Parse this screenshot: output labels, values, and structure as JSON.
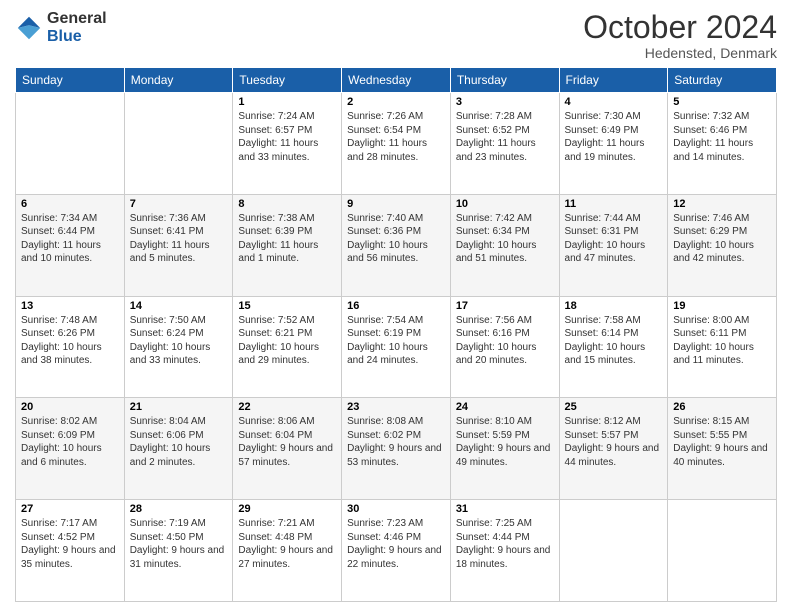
{
  "header": {
    "logo_line1": "General",
    "logo_line2": "Blue",
    "month": "October 2024",
    "location": "Hedensted, Denmark"
  },
  "days_of_week": [
    "Sunday",
    "Monday",
    "Tuesday",
    "Wednesday",
    "Thursday",
    "Friday",
    "Saturday"
  ],
  "weeks": [
    [
      {
        "day": "",
        "info": ""
      },
      {
        "day": "",
        "info": ""
      },
      {
        "day": "1",
        "info": "Sunrise: 7:24 AM\nSunset: 6:57 PM\nDaylight: 11 hours and 33 minutes."
      },
      {
        "day": "2",
        "info": "Sunrise: 7:26 AM\nSunset: 6:54 PM\nDaylight: 11 hours and 28 minutes."
      },
      {
        "day": "3",
        "info": "Sunrise: 7:28 AM\nSunset: 6:52 PM\nDaylight: 11 hours and 23 minutes."
      },
      {
        "day": "4",
        "info": "Sunrise: 7:30 AM\nSunset: 6:49 PM\nDaylight: 11 hours and 19 minutes."
      },
      {
        "day": "5",
        "info": "Sunrise: 7:32 AM\nSunset: 6:46 PM\nDaylight: 11 hours and 14 minutes."
      }
    ],
    [
      {
        "day": "6",
        "info": "Sunrise: 7:34 AM\nSunset: 6:44 PM\nDaylight: 11 hours and 10 minutes."
      },
      {
        "day": "7",
        "info": "Sunrise: 7:36 AM\nSunset: 6:41 PM\nDaylight: 11 hours and 5 minutes."
      },
      {
        "day": "8",
        "info": "Sunrise: 7:38 AM\nSunset: 6:39 PM\nDaylight: 11 hours and 1 minute."
      },
      {
        "day": "9",
        "info": "Sunrise: 7:40 AM\nSunset: 6:36 PM\nDaylight: 10 hours and 56 minutes."
      },
      {
        "day": "10",
        "info": "Sunrise: 7:42 AM\nSunset: 6:34 PM\nDaylight: 10 hours and 51 minutes."
      },
      {
        "day": "11",
        "info": "Sunrise: 7:44 AM\nSunset: 6:31 PM\nDaylight: 10 hours and 47 minutes."
      },
      {
        "day": "12",
        "info": "Sunrise: 7:46 AM\nSunset: 6:29 PM\nDaylight: 10 hours and 42 minutes."
      }
    ],
    [
      {
        "day": "13",
        "info": "Sunrise: 7:48 AM\nSunset: 6:26 PM\nDaylight: 10 hours and 38 minutes."
      },
      {
        "day": "14",
        "info": "Sunrise: 7:50 AM\nSunset: 6:24 PM\nDaylight: 10 hours and 33 minutes."
      },
      {
        "day": "15",
        "info": "Sunrise: 7:52 AM\nSunset: 6:21 PM\nDaylight: 10 hours and 29 minutes."
      },
      {
        "day": "16",
        "info": "Sunrise: 7:54 AM\nSunset: 6:19 PM\nDaylight: 10 hours and 24 minutes."
      },
      {
        "day": "17",
        "info": "Sunrise: 7:56 AM\nSunset: 6:16 PM\nDaylight: 10 hours and 20 minutes."
      },
      {
        "day": "18",
        "info": "Sunrise: 7:58 AM\nSunset: 6:14 PM\nDaylight: 10 hours and 15 minutes."
      },
      {
        "day": "19",
        "info": "Sunrise: 8:00 AM\nSunset: 6:11 PM\nDaylight: 10 hours and 11 minutes."
      }
    ],
    [
      {
        "day": "20",
        "info": "Sunrise: 8:02 AM\nSunset: 6:09 PM\nDaylight: 10 hours and 6 minutes."
      },
      {
        "day": "21",
        "info": "Sunrise: 8:04 AM\nSunset: 6:06 PM\nDaylight: 10 hours and 2 minutes."
      },
      {
        "day": "22",
        "info": "Sunrise: 8:06 AM\nSunset: 6:04 PM\nDaylight: 9 hours and 57 minutes."
      },
      {
        "day": "23",
        "info": "Sunrise: 8:08 AM\nSunset: 6:02 PM\nDaylight: 9 hours and 53 minutes."
      },
      {
        "day": "24",
        "info": "Sunrise: 8:10 AM\nSunset: 5:59 PM\nDaylight: 9 hours and 49 minutes."
      },
      {
        "day": "25",
        "info": "Sunrise: 8:12 AM\nSunset: 5:57 PM\nDaylight: 9 hours and 44 minutes."
      },
      {
        "day": "26",
        "info": "Sunrise: 8:15 AM\nSunset: 5:55 PM\nDaylight: 9 hours and 40 minutes."
      }
    ],
    [
      {
        "day": "27",
        "info": "Sunrise: 7:17 AM\nSunset: 4:52 PM\nDaylight: 9 hours and 35 minutes."
      },
      {
        "day": "28",
        "info": "Sunrise: 7:19 AM\nSunset: 4:50 PM\nDaylight: 9 hours and 31 minutes."
      },
      {
        "day": "29",
        "info": "Sunrise: 7:21 AM\nSunset: 4:48 PM\nDaylight: 9 hours and 27 minutes."
      },
      {
        "day": "30",
        "info": "Sunrise: 7:23 AM\nSunset: 4:46 PM\nDaylight: 9 hours and 22 minutes."
      },
      {
        "day": "31",
        "info": "Sunrise: 7:25 AM\nSunset: 4:44 PM\nDaylight: 9 hours and 18 minutes."
      },
      {
        "day": "",
        "info": ""
      },
      {
        "day": "",
        "info": ""
      }
    ]
  ]
}
